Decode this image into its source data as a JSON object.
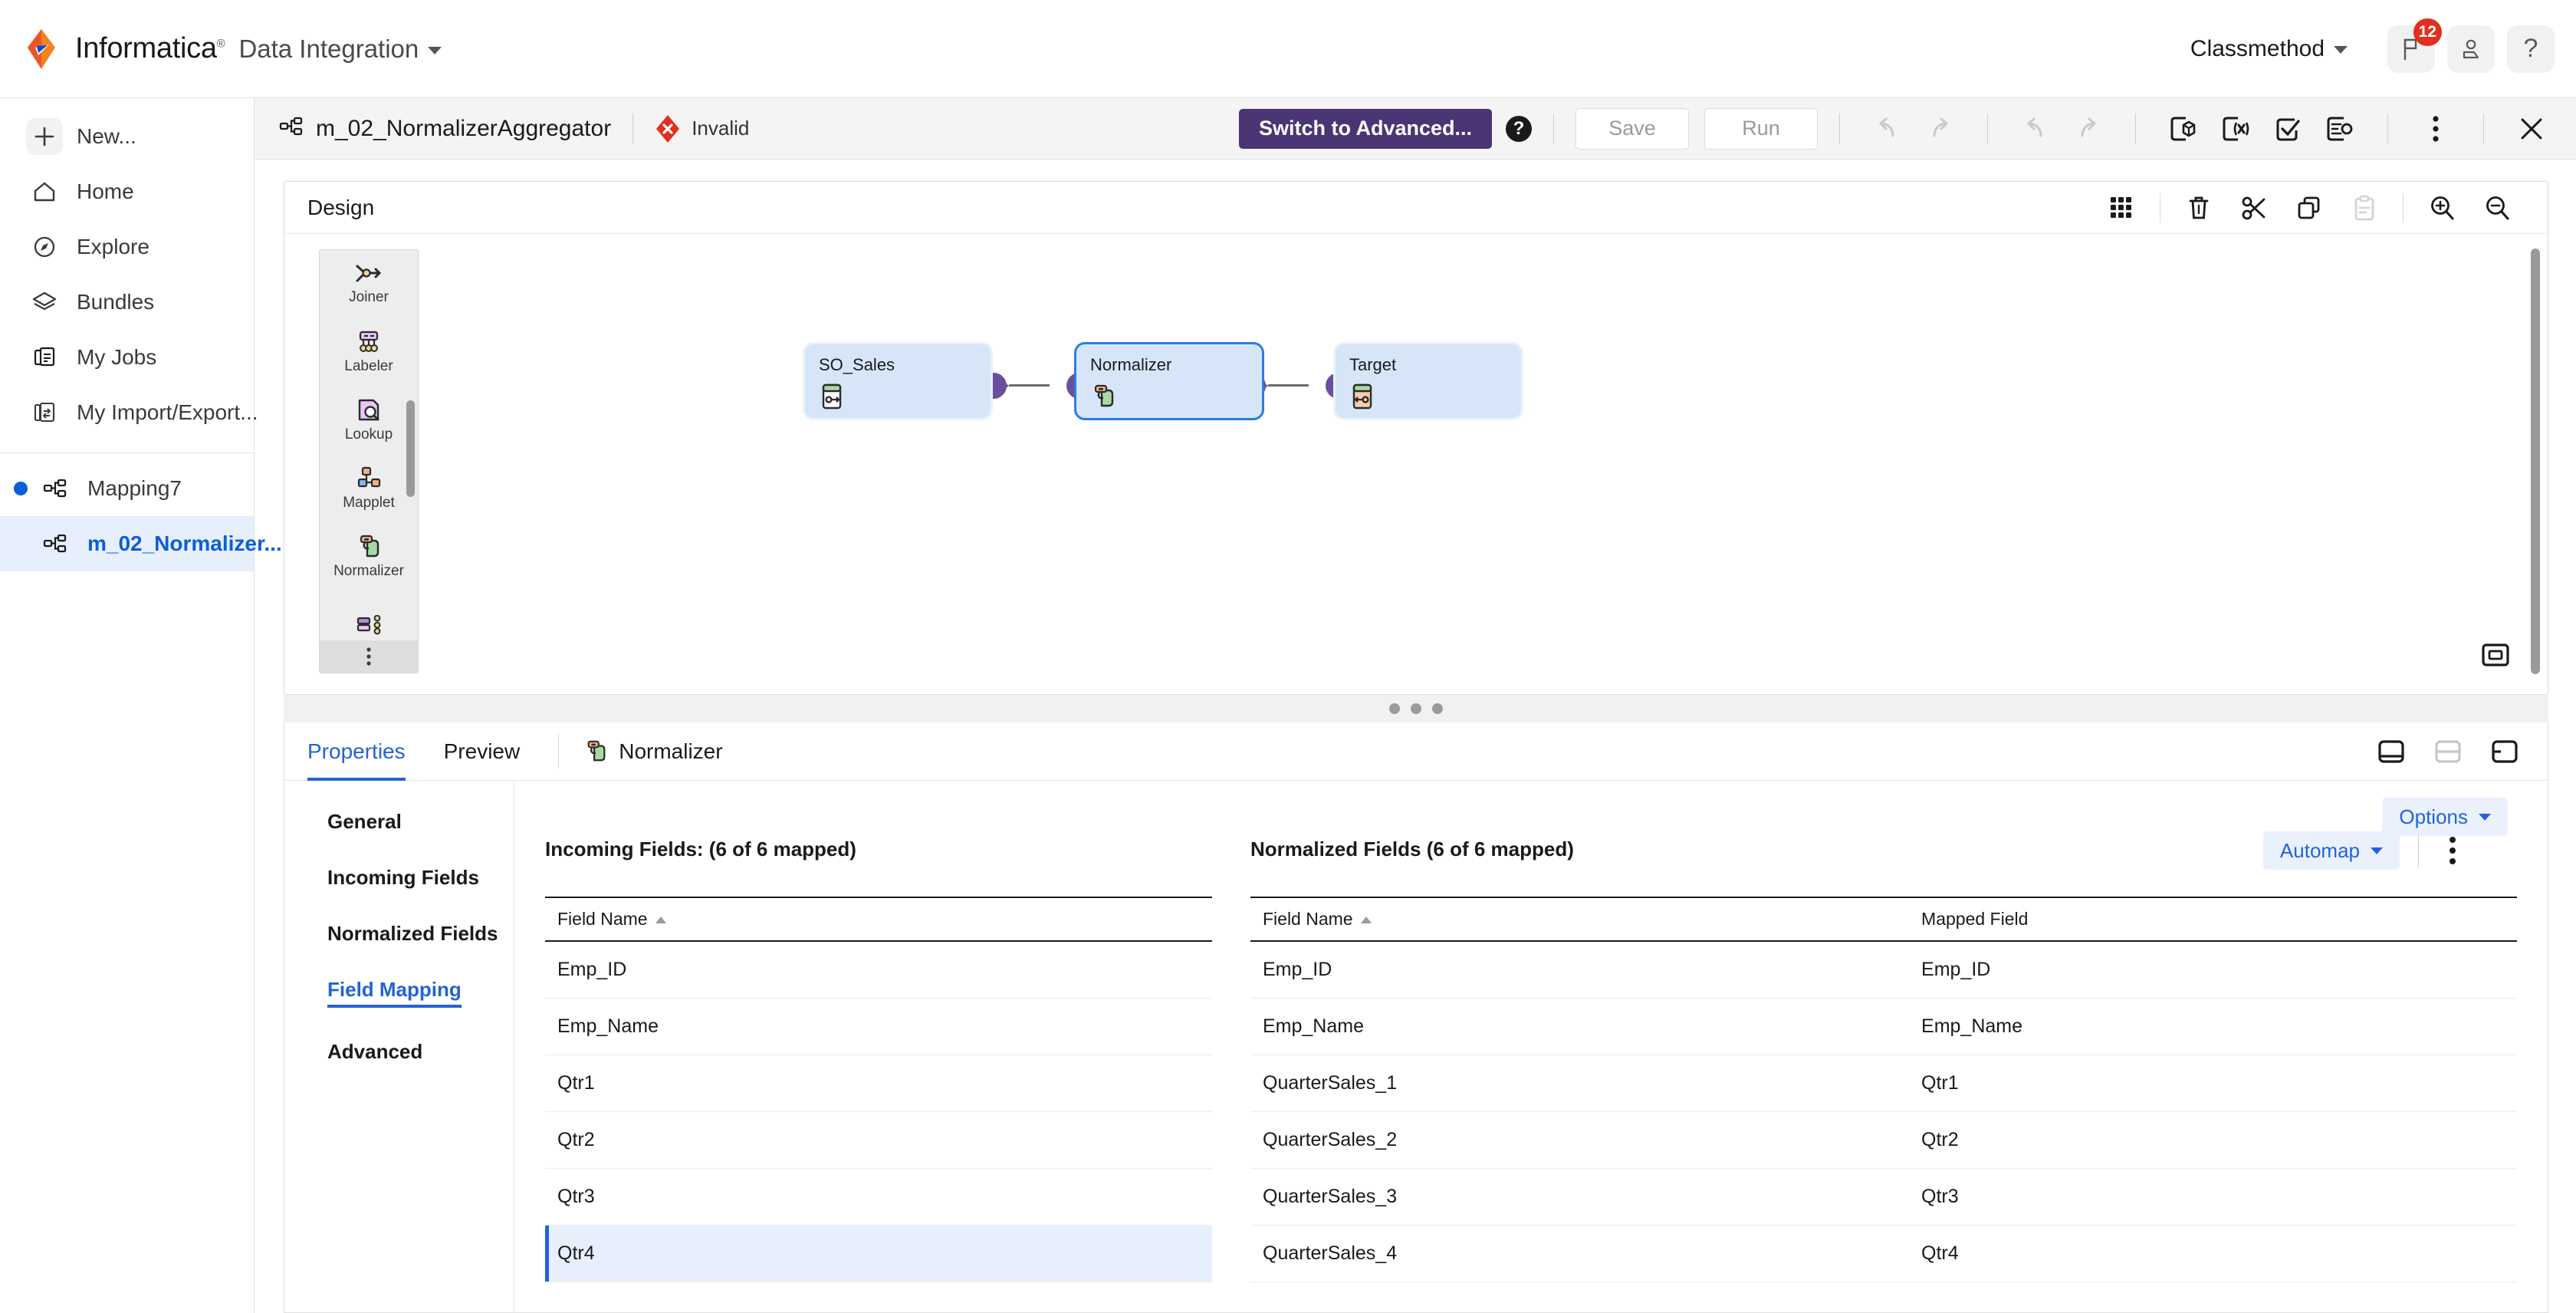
{
  "header": {
    "brand": "Informatica",
    "brand_tm": "®",
    "service": "Data Integration",
    "org": "Classmethod",
    "notification_count": "12",
    "icons": {
      "flag": "flag-icon",
      "user": "user-icon",
      "help": "?"
    }
  },
  "sidebar": {
    "items": [
      {
        "label": "New...",
        "icon": "plus-icon"
      },
      {
        "label": "Home",
        "icon": "home-icon"
      },
      {
        "label": "Explore",
        "icon": "compass-icon"
      },
      {
        "label": "Bundles",
        "icon": "layers-icon"
      },
      {
        "label": "My Jobs",
        "icon": "jobs-icon"
      },
      {
        "label": "My Import/Export...",
        "icon": "import-export-icon"
      }
    ],
    "documents": [
      {
        "label": "Mapping7",
        "icon": "mapping-icon",
        "modified": true,
        "active": false
      },
      {
        "label": "m_02_Normalizer...",
        "icon": "mapping-icon",
        "modified": false,
        "active": true
      }
    ]
  },
  "maptoolbar": {
    "title": "m_02_NormalizerAggregator",
    "status": "Invalid",
    "switch_advanced": "Switch to Advanced...",
    "help": "?",
    "save": "Save",
    "run": "Run",
    "icons": [
      "undo-icon",
      "redo-icon",
      "undo-all-icon",
      "redo-all-icon",
      "parameters-icon",
      "expression-macro-icon",
      "validate-icon",
      "mapping-summary-icon",
      "more-options-icon",
      "close-icon"
    ]
  },
  "design": {
    "title": "Design",
    "toolbar_icons": [
      "grid-icon",
      "delete-icon",
      "cut-icon",
      "copy-icon",
      "paste-icon",
      "zoom-in-icon",
      "zoom-out-icon"
    ],
    "palette": [
      {
        "label": "Joiner",
        "icon": "joiner-icon"
      },
      {
        "label": "Labeler",
        "icon": "labeler-icon"
      },
      {
        "label": "Lookup",
        "icon": "lookup-icon"
      },
      {
        "label": "Mapplet",
        "icon": "mapplet-icon"
      },
      {
        "label": "Normalizer",
        "icon": "normalizer-icon"
      }
    ],
    "palette_more": "more-icon",
    "nodes": [
      {
        "label": "SO_Sales",
        "icon": "source-icon",
        "selected": false
      },
      {
        "label": "Normalizer",
        "icon": "normalizer-icon",
        "selected": true
      },
      {
        "label": "Target",
        "icon": "target-icon",
        "selected": false
      }
    ],
    "minimap": "minimap-icon"
  },
  "bottom": {
    "tabs": [
      {
        "label": "Properties",
        "active": true
      },
      {
        "label": "Preview",
        "active": false
      }
    ],
    "transformation_tab": "Normalizer",
    "layout_icons": [
      "layout-bottom-icon",
      "layout-split-icon",
      "layout-side-icon"
    ],
    "prop_nav": [
      {
        "label": "General",
        "active": false
      },
      {
        "label": "Incoming Fields",
        "active": false
      },
      {
        "label": "Normalized Fields",
        "active": false
      },
      {
        "label": "Field Mapping",
        "active": true
      },
      {
        "label": "Advanced",
        "active": false
      }
    ],
    "options_label": "Options",
    "automap_label": "Automap",
    "incoming": {
      "title": "Incoming Fields: (6 of 6 mapped)",
      "columns": [
        "Field Name"
      ],
      "rows": [
        {
          "field": "Emp_ID",
          "selected": false
        },
        {
          "field": "Emp_Name",
          "selected": false
        },
        {
          "field": "Qtr1",
          "selected": false
        },
        {
          "field": "Qtr2",
          "selected": false
        },
        {
          "field": "Qtr3",
          "selected": false
        },
        {
          "field": "Qtr4",
          "selected": true
        }
      ]
    },
    "normalized": {
      "title": "Normalized Fields (6 of 6 mapped)",
      "columns": [
        "Field Name",
        "Mapped Field"
      ],
      "rows": [
        {
          "field": "Emp_ID",
          "mapped": "Emp_ID"
        },
        {
          "field": "Emp_Name",
          "mapped": "Emp_Name"
        },
        {
          "field": "QuarterSales_1",
          "mapped": "Qtr1"
        },
        {
          "field": "QuarterSales_2",
          "mapped": "Qtr2"
        },
        {
          "field": "QuarterSales_3",
          "mapped": "Qtr3"
        },
        {
          "field": "QuarterSales_4",
          "mapped": "Qtr4"
        }
      ]
    }
  },
  "colors": {
    "accent_blue": "#2263d6",
    "advanced_purple": "#4b3473",
    "invalid_red": "#e0301e",
    "node_fill": "#d6e6f8",
    "port_purple": "#6b4f9e",
    "badge_red": "#e0301e"
  }
}
